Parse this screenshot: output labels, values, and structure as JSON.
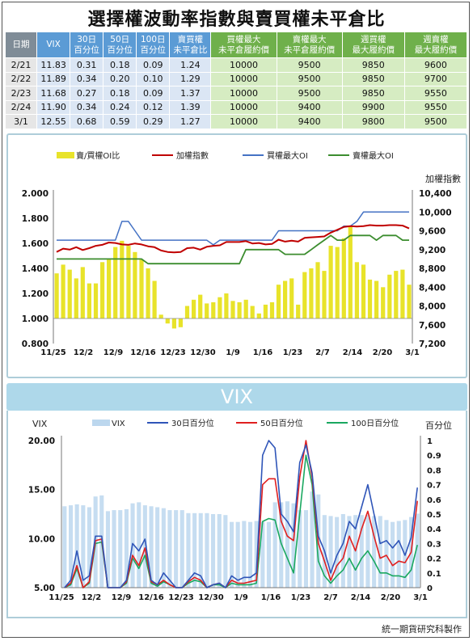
{
  "title": "選擇權波動率指數與賣買權未平倉比",
  "table": {
    "headers": [
      "日期",
      "VIX",
      "30日\n百分位",
      "50日\n百分位",
      "100日\n百分位",
      "賣買權\n未平倉比",
      "買權最大\n未平倉履約價",
      "賣權最大\n未平倉履約價",
      "週買權\n最大履約價",
      "週賣權\n最大履約價"
    ],
    "rows": [
      [
        "2/21",
        "11.83",
        "0.31",
        "0.18",
        "0.09",
        "1.24",
        "10000",
        "9500",
        "9850",
        "9600"
      ],
      [
        "2/22",
        "11.89",
        "0.34",
        "0.20",
        "0.10",
        "1.29",
        "10000",
        "9500",
        "9850",
        "9700"
      ],
      [
        "2/23",
        "11.68",
        "0.27",
        "0.18",
        "0.09",
        "1.37",
        "10000",
        "9500",
        "9850",
        "9550"
      ],
      [
        "2/24",
        "11.90",
        "0.34",
        "0.24",
        "0.12",
        "1.39",
        "10000",
        "9400",
        "9900",
        "9550"
      ],
      [
        "3/1",
        "12.55",
        "0.68",
        "0.59",
        "0.29",
        "1.27",
        "10000",
        "9400",
        "9800",
        "9500"
      ]
    ]
  },
  "colors": {
    "ratio_bar": "#e8e32a",
    "index_line": "#c00000",
    "call_max": "#4472c4",
    "put_max": "#3c8d2f",
    "vix_bar": "#bcd7ee",
    "p30": "#2f55b8",
    "p50": "#e02020",
    "p100": "#1aa860"
  },
  "chart_data": [
    {
      "type": "bar",
      "legend": [
        "賣/買權OI比",
        "加權指數",
        "買權最大OI",
        "賣權最大OI"
      ],
      "ylabel_right": "加權指數",
      "ylim": [
        0.8,
        2.0
      ],
      "ylim_right": [
        7200,
        10400
      ],
      "yticks": [
        "2.000",
        "1.800",
        "1.600",
        "1.400",
        "1.200",
        "1.000",
        "0.800"
      ],
      "yticks_right": [
        "10,400",
        "10,000",
        "9,600",
        "9,200",
        "8,800",
        "8,400",
        "8,000",
        "7,600",
        "7,200"
      ],
      "xticks": [
        "11/25",
        "12/2",
        "12/9",
        "12/16",
        "12/23",
        "12/30",
        "1/9",
        "1/16",
        "1/23",
        "2/7",
        "2/14",
        "2/20",
        "3/1"
      ],
      "ratio": [
        1.36,
        1.43,
        1.39,
        1.32,
        1.41,
        1.28,
        1.28,
        1.45,
        1.47,
        1.57,
        1.62,
        1.58,
        1.53,
        1.47,
        1.4,
        1.3,
        1.03,
        0.96,
        0.92,
        0.93,
        1.1,
        1.15,
        1.19,
        1.12,
        1.13,
        1.17,
        1.2,
        1.14,
        1.13,
        1.15,
        1.1,
        1.04,
        1.11,
        1.13,
        1.27,
        1.3,
        1.32,
        1.11,
        1.37,
        1.4,
        1.45,
        1.38,
        1.58,
        1.57,
        1.64,
        1.73,
        1.45,
        1.43,
        1.31,
        1.3,
        1.25,
        1.35,
        1.38,
        1.39,
        1.27
      ],
      "index": [
        9150,
        9220,
        9200,
        9250,
        9190,
        9230,
        9280,
        9300,
        9350,
        9340,
        9310,
        9300,
        9330,
        9310,
        9270,
        9250,
        9180,
        9150,
        9140,
        9150,
        9230,
        9240,
        9200,
        9260,
        9280,
        9290,
        9360,
        9360,
        9360,
        9380,
        9330,
        9340,
        9310,
        9320,
        9410,
        9370,
        9390,
        9370,
        9450,
        9460,
        9470,
        9480,
        9560,
        9620,
        9680,
        9700,
        9690,
        9700,
        9720,
        9710,
        9710,
        9720,
        9720,
        9710,
        9650
      ],
      "call_max": [
        9400,
        9400,
        9400,
        9400,
        9400,
        9400,
        9400,
        9400,
        9400,
        9400,
        9800,
        9800,
        9600,
        9400,
        9400,
        9400,
        9400,
        9400,
        9400,
        9400,
        9400,
        9400,
        9400,
        9400,
        9300,
        9400,
        9400,
        9400,
        9400,
        9400,
        9400,
        9400,
        9400,
        9400,
        9600,
        9600,
        9600,
        9600,
        9600,
        9600,
        9600,
        9600,
        9600,
        9600,
        9700,
        9700,
        9800,
        10000,
        10000,
        10000,
        10000,
        10000,
        10000,
        10000,
        10000
      ],
      "put_max": [
        9000,
        9000,
        9000,
        9000,
        9000,
        9000,
        9000,
        9000,
        9000,
        9000,
        9000,
        9000,
        9000,
        9000,
        8900,
        8900,
        8900,
        8900,
        8900,
        8900,
        8900,
        8900,
        8900,
        8900,
        8900,
        8900,
        8900,
        8900,
        8900,
        9200,
        9200,
        9200,
        9200,
        9200,
        9200,
        9100,
        9100,
        9100,
        9100,
        9200,
        9300,
        9400,
        9500,
        9400,
        9400,
        9500,
        9500,
        9500,
        9500,
        9400,
        9500,
        9500,
        9500,
        9400,
        9400
      ]
    },
    {
      "type": "line",
      "banner": "VIX",
      "legend": [
        "VIX",
        "30日百分位",
        "50日百分位",
        "100日百分位"
      ],
      "ylabel": "VIX",
      "ylabel_right": "百分位",
      "ylim": [
        5,
        20
      ],
      "ylim_right": [
        0,
        1
      ],
      "yticks": [
        "20.00",
        "15.00",
        "10.00",
        "5.00"
      ],
      "yticks_right": [
        "1",
        "0.9",
        "0.8",
        "0.7",
        "0.6",
        "0.5",
        "0.4",
        "0.3",
        "0.2",
        "0.1",
        "0"
      ],
      "xticks": [
        "11/25",
        "12/2",
        "12/9",
        "12/16",
        "12/23",
        "12/30",
        "1/9",
        "1/16",
        "1/23",
        "2/7",
        "2/14",
        "2/20",
        "3/1"
      ],
      "vix": [
        13.3,
        13.4,
        13.5,
        13.4,
        13.2,
        14.3,
        14.4,
        12.8,
        12.9,
        12.9,
        13.0,
        13.6,
        13.7,
        13.4,
        13.3,
        13.2,
        13.1,
        12.9,
        12.9,
        12.9,
        12.6,
        12.6,
        12.6,
        12.6,
        12.5,
        12.5,
        12.4,
        11.7,
        11.7,
        11.8,
        11.7,
        11.8,
        11.7,
        11.7,
        13.7,
        13.7,
        13.8,
        13.6,
        12.9,
        12.9,
        14.8,
        14.5,
        12.4,
        12.3,
        12.2,
        12.5,
        12.3,
        12.4,
        12.4,
        12.4,
        12.3,
        12.3,
        11.9,
        11.7,
        11.8,
        11.9,
        12.2,
        12.55
      ],
      "p30": [
        0.0,
        0.05,
        0.25,
        0.05,
        0.08,
        0.35,
        0.35,
        0.0,
        0.0,
        0.0,
        0.05,
        0.3,
        0.25,
        0.33,
        0.05,
        0.02,
        0.1,
        0.05,
        0.0,
        0.0,
        0.05,
        0.1,
        0.08,
        0.0,
        0.02,
        0.03,
        0.0,
        0.08,
        0.05,
        0.07,
        0.07,
        0.1,
        0.9,
        1.0,
        0.95,
        0.5,
        0.45,
        0.38,
        0.85,
        0.97,
        0.78,
        0.35,
        0.25,
        0.1,
        0.22,
        0.3,
        0.45,
        0.4,
        0.55,
        0.7,
        0.5,
        0.3,
        0.32,
        0.27,
        0.32,
        0.22,
        0.34,
        0.68
      ],
      "p50": [
        0.0,
        0.03,
        0.15,
        0.0,
        0.04,
        0.32,
        0.33,
        0.0,
        0.0,
        0.0,
        0.04,
        0.22,
        0.15,
        0.27,
        0.04,
        0.02,
        0.05,
        0.02,
        0.0,
        0.0,
        0.04,
        0.07,
        0.05,
        0.0,
        0.02,
        0.03,
        0.0,
        0.05,
        0.03,
        0.03,
        0.04,
        0.05,
        0.7,
        0.74,
        0.74,
        0.45,
        0.35,
        0.32,
        0.75,
        1.0,
        0.75,
        0.3,
        0.18,
        0.05,
        0.15,
        0.2,
        0.35,
        0.25,
        0.4,
        0.52,
        0.35,
        0.2,
        0.22,
        0.15,
        0.18,
        0.17,
        0.24,
        0.59
      ],
      "p100": [
        0.0,
        0.02,
        0.13,
        0.0,
        0.03,
        0.3,
        0.31,
        0.0,
        0.0,
        0.0,
        0.03,
        0.2,
        0.13,
        0.22,
        0.03,
        0.01,
        0.04,
        0.02,
        0.0,
        0.0,
        0.03,
        0.05,
        0.04,
        0.0,
        0.02,
        0.02,
        0.0,
        0.03,
        0.02,
        0.02,
        0.02,
        0.03,
        0.45,
        0.47,
        0.46,
        0.3,
        0.2,
        0.1,
        0.5,
        0.9,
        0.7,
        0.18,
        0.08,
        0.03,
        0.08,
        0.12,
        0.2,
        0.12,
        0.2,
        0.25,
        0.18,
        0.1,
        0.1,
        0.08,
        0.08,
        0.07,
        0.12,
        0.29
      ]
    }
  ],
  "footer": "統一期貨研究科製作"
}
